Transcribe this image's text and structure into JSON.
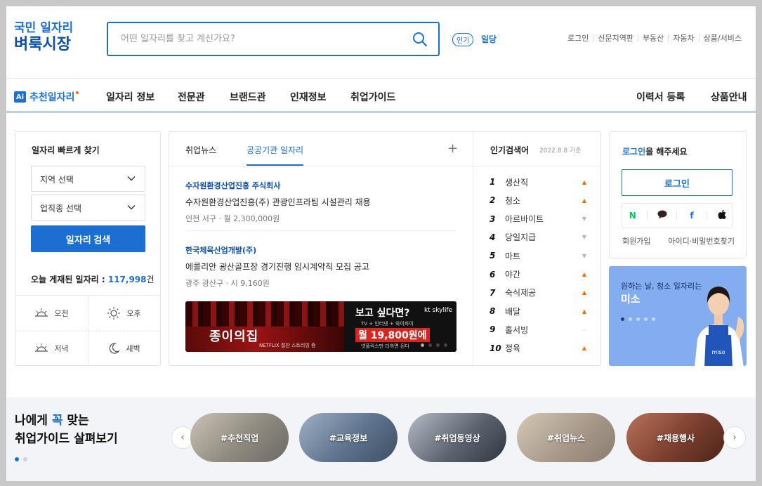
{
  "header": {
    "logo_line1": "국민 일자리",
    "logo_line2": "벼룩시장",
    "search_placeholder": "어떤 일자리를 찾고 계신가요?",
    "popular_badge": "인기",
    "popular_word": "일당",
    "utils": [
      "로그인",
      "신문지역판",
      "부동산",
      "자동차",
      "상품/서비스"
    ]
  },
  "nav": {
    "ai_icon": "Ai",
    "ai_label": "추천일자리",
    "items": [
      "일자리 정보",
      "전문관",
      "브랜드관",
      "인재정보",
      "취업가이드"
    ],
    "right_items": [
      "이력서 등록",
      "상품안내"
    ]
  },
  "quick": {
    "title": "일자리 빠르게 찾기",
    "region": "지역 선택",
    "category": "업직종 선택",
    "search_button": "일자리 검색",
    "today_label": "오늘 게재된 일자리 :",
    "today_count": "117,998",
    "today_unit": "건",
    "times": [
      {
        "label": "오전",
        "icon": "sunrise-icon"
      },
      {
        "label": "오후",
        "icon": "sun-icon"
      },
      {
        "label": "저녁",
        "icon": "sunset-icon"
      },
      {
        "label": "새벽",
        "icon": "moon-icon"
      }
    ]
  },
  "news": {
    "tabs": [
      "취업뉴스",
      "공공기관 일자리"
    ],
    "jobs": [
      {
        "company": "수자원환경산업진흥 주식회사",
        "title": "수자원환경산업진흥(주) 관광인프라팀 시설관리 채용",
        "location": "인천 서구",
        "pay": "월 2,300,000원"
      },
      {
        "company": "한국체육산업개발(주)",
        "title": "에콜리안 광산골프장 경기진행 임시계약직 모집 공고",
        "location": "광주 광산구",
        "pay": "시 9,160원"
      }
    ],
    "banner": {
      "drama_title": "종이의집",
      "drama_sub": "NETFLIX  절찬 스트리밍 중",
      "headline": "보고 싶다면?",
      "brand": "kt skylife",
      "sub": "TV + 인터넷 + 와이파이",
      "price": "월 19,800원에",
      "note": "넷플릭스만 더하면 된다"
    }
  },
  "ranks": {
    "title": "인기검색어",
    "date": "2022.8.8 기준",
    "items": [
      {
        "rank": "1",
        "word": "생산직",
        "trend": "up"
      },
      {
        "rank": "2",
        "word": "청소",
        "trend": "up"
      },
      {
        "rank": "3",
        "word": "아르바이트",
        "trend": "down"
      },
      {
        "rank": "4",
        "word": "당일지급",
        "trend": "down"
      },
      {
        "rank": "5",
        "word": "마트",
        "trend": "down"
      },
      {
        "rank": "6",
        "word": "야간",
        "trend": "up"
      },
      {
        "rank": "7",
        "word": "숙식제공",
        "trend": "up"
      },
      {
        "rank": "8",
        "word": "배달",
        "trend": "up"
      },
      {
        "rank": "9",
        "word": "홀서빙",
        "trend": "same"
      },
      {
        "rank": "10",
        "word": "정육",
        "trend": "up"
      }
    ],
    "colors": {
      "up": "#ff6a00",
      "down": "#b5b5b5",
      "same": "#b5b5b5"
    }
  },
  "login": {
    "msg_highlight": "로그인",
    "msg_rest": "을 해주세요",
    "button": "로그인",
    "social": [
      {
        "label": "N",
        "icon": "naver-icon",
        "color": "#03c75a"
      },
      {
        "label": "●",
        "icon": "kakao-icon",
        "color": "#3a1d1d"
      },
      {
        "label": "f",
        "icon": "facebook-icon",
        "color": "#1877f2"
      },
      {
        "label": "",
        "icon": "apple-icon",
        "color": "#111111"
      }
    ],
    "signup": "회원가입",
    "find": "아이디·비밀번호찾기"
  },
  "promo": {
    "line1": "원하는 날, 청소 일자리는",
    "line2": "미소",
    "apron_text": "miso"
  },
  "guide": {
    "line1_a": "나에게 ",
    "line1_hl": "꼭",
    "line1_b": " 맞는",
    "line2": "취업가이드 살펴보기",
    "tags": [
      "#추천직업",
      "#교육정보",
      "#취업동영상",
      "#취업뉴스",
      "#채용행사"
    ]
  },
  "colors": {
    "accent": "#1a6fd1",
    "hot": "#ff6a00"
  }
}
